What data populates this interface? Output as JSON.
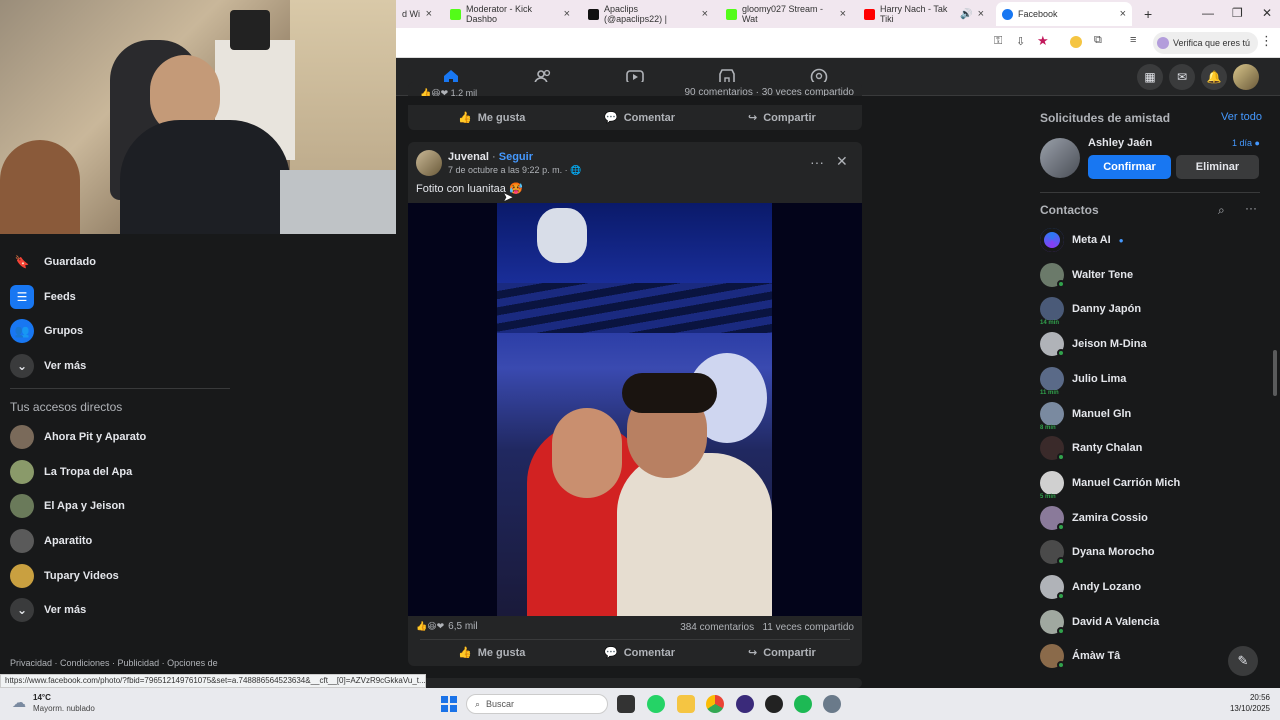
{
  "browser": {
    "tabs": [
      {
        "label": "d Wi",
        "color": "#9aa0a6"
      },
      {
        "label": "Moderator - Kick Dashbo",
        "color": "#53fc18"
      },
      {
        "label": "Apaclips (@apaclips22) |",
        "color": "#111111"
      },
      {
        "label": "gloomy027 Stream - Wat",
        "color": "#53fc18"
      },
      {
        "label": "Harry Nach - Tak Tiki",
        "color": "#ff0000"
      },
      {
        "label": "Facebook",
        "color": "#1877f2"
      }
    ],
    "profile_label": "Verifica que eres tú",
    "status_url": "https://www.facebook.com/photo/?fbid=796512149761075&set=a.748886564523634&__cft__[0]=AZVzR9cGkkaVu_t..."
  },
  "left_sidebar": {
    "items": [
      {
        "label": "Guardado",
        "icon": "bookmark-icon"
      },
      {
        "label": "Feeds",
        "icon": "feeds-icon"
      },
      {
        "label": "Grupos",
        "icon": "groups-icon"
      },
      {
        "label": "Ver más",
        "icon": "chevron-down-icon"
      }
    ],
    "shortcuts_title": "Tus accesos directos",
    "shortcuts": [
      {
        "label": "Ahora Pit y Aparato"
      },
      {
        "label": "La Tropa del Apa"
      },
      {
        "label": "El Apa y Jeison"
      },
      {
        "label": "Aparatito"
      },
      {
        "label": "Tupary Videos"
      },
      {
        "label": "Ver más"
      }
    ],
    "footer": "Privacidad · Condiciones · Publicidad · Opciones de"
  },
  "prev_post": {
    "stats_partial": "90 comentarios · 30 veces compartido",
    "like": "Me gusta",
    "comment": "Comentar",
    "share": "Compartir"
  },
  "post": {
    "author": "Juvenal",
    "follow": "Seguir",
    "timestamp": "7 de octubre a las 9:22 p. m. ·",
    "caption": "Fotito con luanitaa",
    "reactions_count": "6,5 mil",
    "comments": "384 comentarios",
    "shares": "11 veces compartido",
    "like": "Me gusta",
    "comment": "Comentar",
    "share": "Compartir"
  },
  "right_sidebar": {
    "requests_title": "Solicitudes de amistad",
    "see_all": "Ver todo",
    "request_name": "Ashley Jaén",
    "request_time": "1 día",
    "confirm": "Confirmar",
    "delete": "Eliminar",
    "contacts_title": "Contactos",
    "contacts": [
      {
        "name": "Meta AI",
        "status": "",
        "color": "#6b5bd6"
      },
      {
        "name": "Walter Tene",
        "status": "online",
        "color": "#6b7a6a"
      },
      {
        "name": "Danny Japón",
        "status": "14 min",
        "color": "#4a5a78"
      },
      {
        "name": "Jeison M-Dina",
        "status": "online",
        "color": "#b0b3b8"
      },
      {
        "name": "Julio Lima",
        "status": "11 min",
        "color": "#5a6a88"
      },
      {
        "name": "Manuel Gln",
        "status": "8 min",
        "color": "#7a8aa0"
      },
      {
        "name": "Ranty Chalan",
        "status": "online",
        "color": "#3a2a2a"
      },
      {
        "name": "Manuel Carrión Mich",
        "status": "5 min",
        "color": "#d0d0d0"
      },
      {
        "name": "Zamira Cossio",
        "status": "online",
        "color": "#8a7a9a"
      },
      {
        "name": "Dyana Morocho",
        "status": "online",
        "color": "#4a4a4a"
      },
      {
        "name": "Andy Lozano",
        "status": "online",
        "color": "#b0b3b8"
      },
      {
        "name": "David A Valencia",
        "status": "online",
        "color": "#a0a8a0"
      },
      {
        "name": "Ámàw Tâ",
        "status": "online",
        "color": "#8a6a4a"
      }
    ]
  },
  "taskbar": {
    "weather_temp": "14°C",
    "weather_desc": "Mayorm. nublado",
    "search_placeholder": "Buscar",
    "time": "20:56",
    "date": "13/10/2025"
  },
  "colors": {
    "accent": "#1877f2",
    "link": "#4599ff",
    "bg": "#18191a",
    "card": "#242526"
  }
}
